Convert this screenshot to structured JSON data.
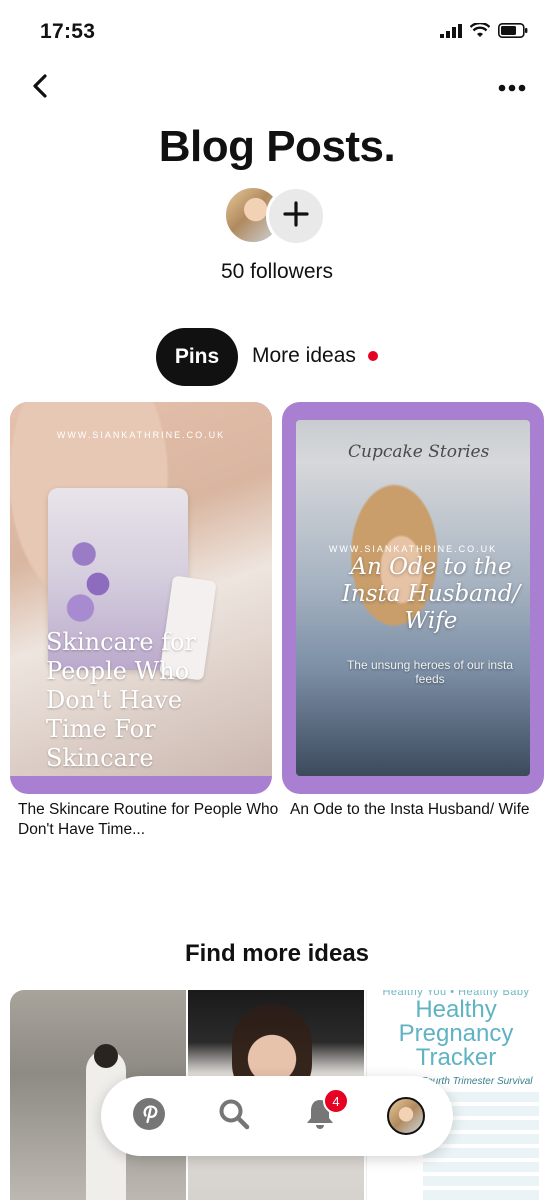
{
  "status_bar": {
    "time": "17:53",
    "icons": [
      "signal-icon",
      "wifi-icon",
      "battery-icon"
    ]
  },
  "nav": {
    "back_icon": "chevron-left-icon",
    "more_icon": "ellipsis-icon"
  },
  "board": {
    "title": "Blog Posts.",
    "followers": "50 followers",
    "add_collaborator_icon": "plus-icon"
  },
  "tabs": {
    "pins": "Pins",
    "more_ideas": "More ideas",
    "more_ideas_indicator_color": "#e60023"
  },
  "pins": [
    {
      "watermark": "WWW.SIANKATHRINE.CO.UK",
      "overlay": "Skincare for People Who Don't Have Time For Skincare",
      "title": "The Skincare Routine for People Who Don't Have Time..."
    },
    {
      "sign": "Cupcake Stories",
      "watermark": "WWW.SIANKATHRINE.CO.UK",
      "overlay": "An Ode to the Insta Husband/ Wife",
      "overlay_sub": "The unsung heroes of our insta feeds",
      "title": "An Ode to the Insta Husband/ Wife"
    }
  ],
  "find_more": {
    "heading": "Find more ideas",
    "ideas": [
      {
        "image": "fashion-photo"
      },
      {
        "image": "portrait-photo"
      },
      {
        "top": "Healthy You • Healthy Baby",
        "title": "Healthy Pregnancy Tracker",
        "sub": "Fourth Trimester Survival Plan"
      }
    ]
  },
  "bottom_nav": {
    "items": [
      "home-icon",
      "search-icon",
      "bell-icon",
      "profile-icon"
    ],
    "notification_count": "4",
    "accent": "#e60023"
  }
}
